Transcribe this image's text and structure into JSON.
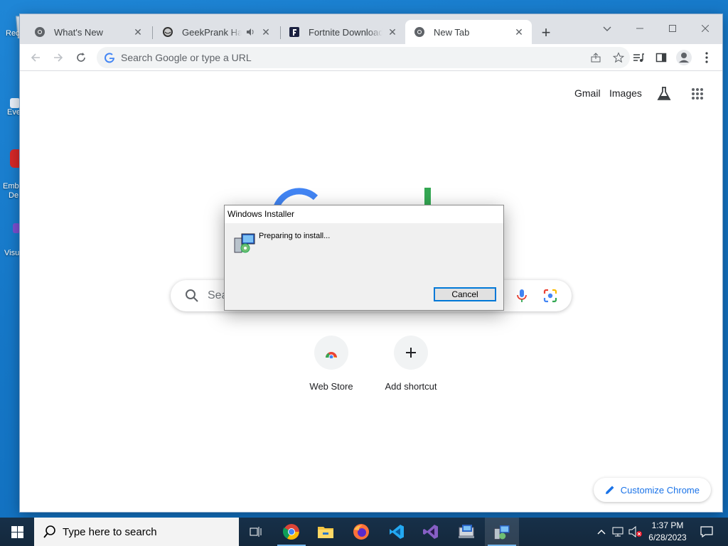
{
  "desktop": {
    "icons": [
      {
        "label": "Rec",
        "icon": "recycle-bin-icon"
      },
      {
        "label": "Eve",
        "icon": "shortcut-icon"
      },
      {
        "label": "Emb",
        "label2": "De",
        "icon": "shortcut-icon"
      },
      {
        "label": "Visu",
        "icon": "visual-studio-shortcut-icon"
      }
    ]
  },
  "browser": {
    "tabs": [
      {
        "title": "What's New",
        "icon": "chrome-icon"
      },
      {
        "title": "GeekPrank Hacker",
        "icon": "geekprank-icon",
        "audio": true
      },
      {
        "title": "Fortnite Download | Ac",
        "icon": "fortnite-icon"
      },
      {
        "title": "New Tab",
        "icon": "chrome-icon",
        "active": true
      }
    ],
    "omnibox_placeholder": "Search Google or type a URL",
    "ntp": {
      "links": {
        "gmail": "Gmail",
        "images": "Images"
      },
      "search_placeholder": "Search Google or type a URL",
      "search_visible": "Sea",
      "shortcuts": [
        {
          "label": "Web Store",
          "icon": "web-store-icon"
        },
        {
          "label": "Add shortcut",
          "icon": "plus-icon"
        }
      ],
      "customize": "Customize Chrome"
    }
  },
  "dialog": {
    "title": "Windows Installer",
    "message": "Preparing to install...",
    "cancel": "Cancel"
  },
  "taskbar": {
    "search_placeholder": "Type here to search",
    "apps": [
      "task-view-icon",
      "chrome-icon",
      "file-explorer-icon",
      "firefox-icon",
      "visual-studio-code-icon",
      "visual-studio-icon",
      "installer-app-icon",
      "windows-installer-icon"
    ],
    "time": "1:37 PM",
    "date": "6/28/2023"
  },
  "colors": {
    "accent": "#1a73e8",
    "taskbar": "#14283c",
    "desktop": "#1577c7"
  }
}
